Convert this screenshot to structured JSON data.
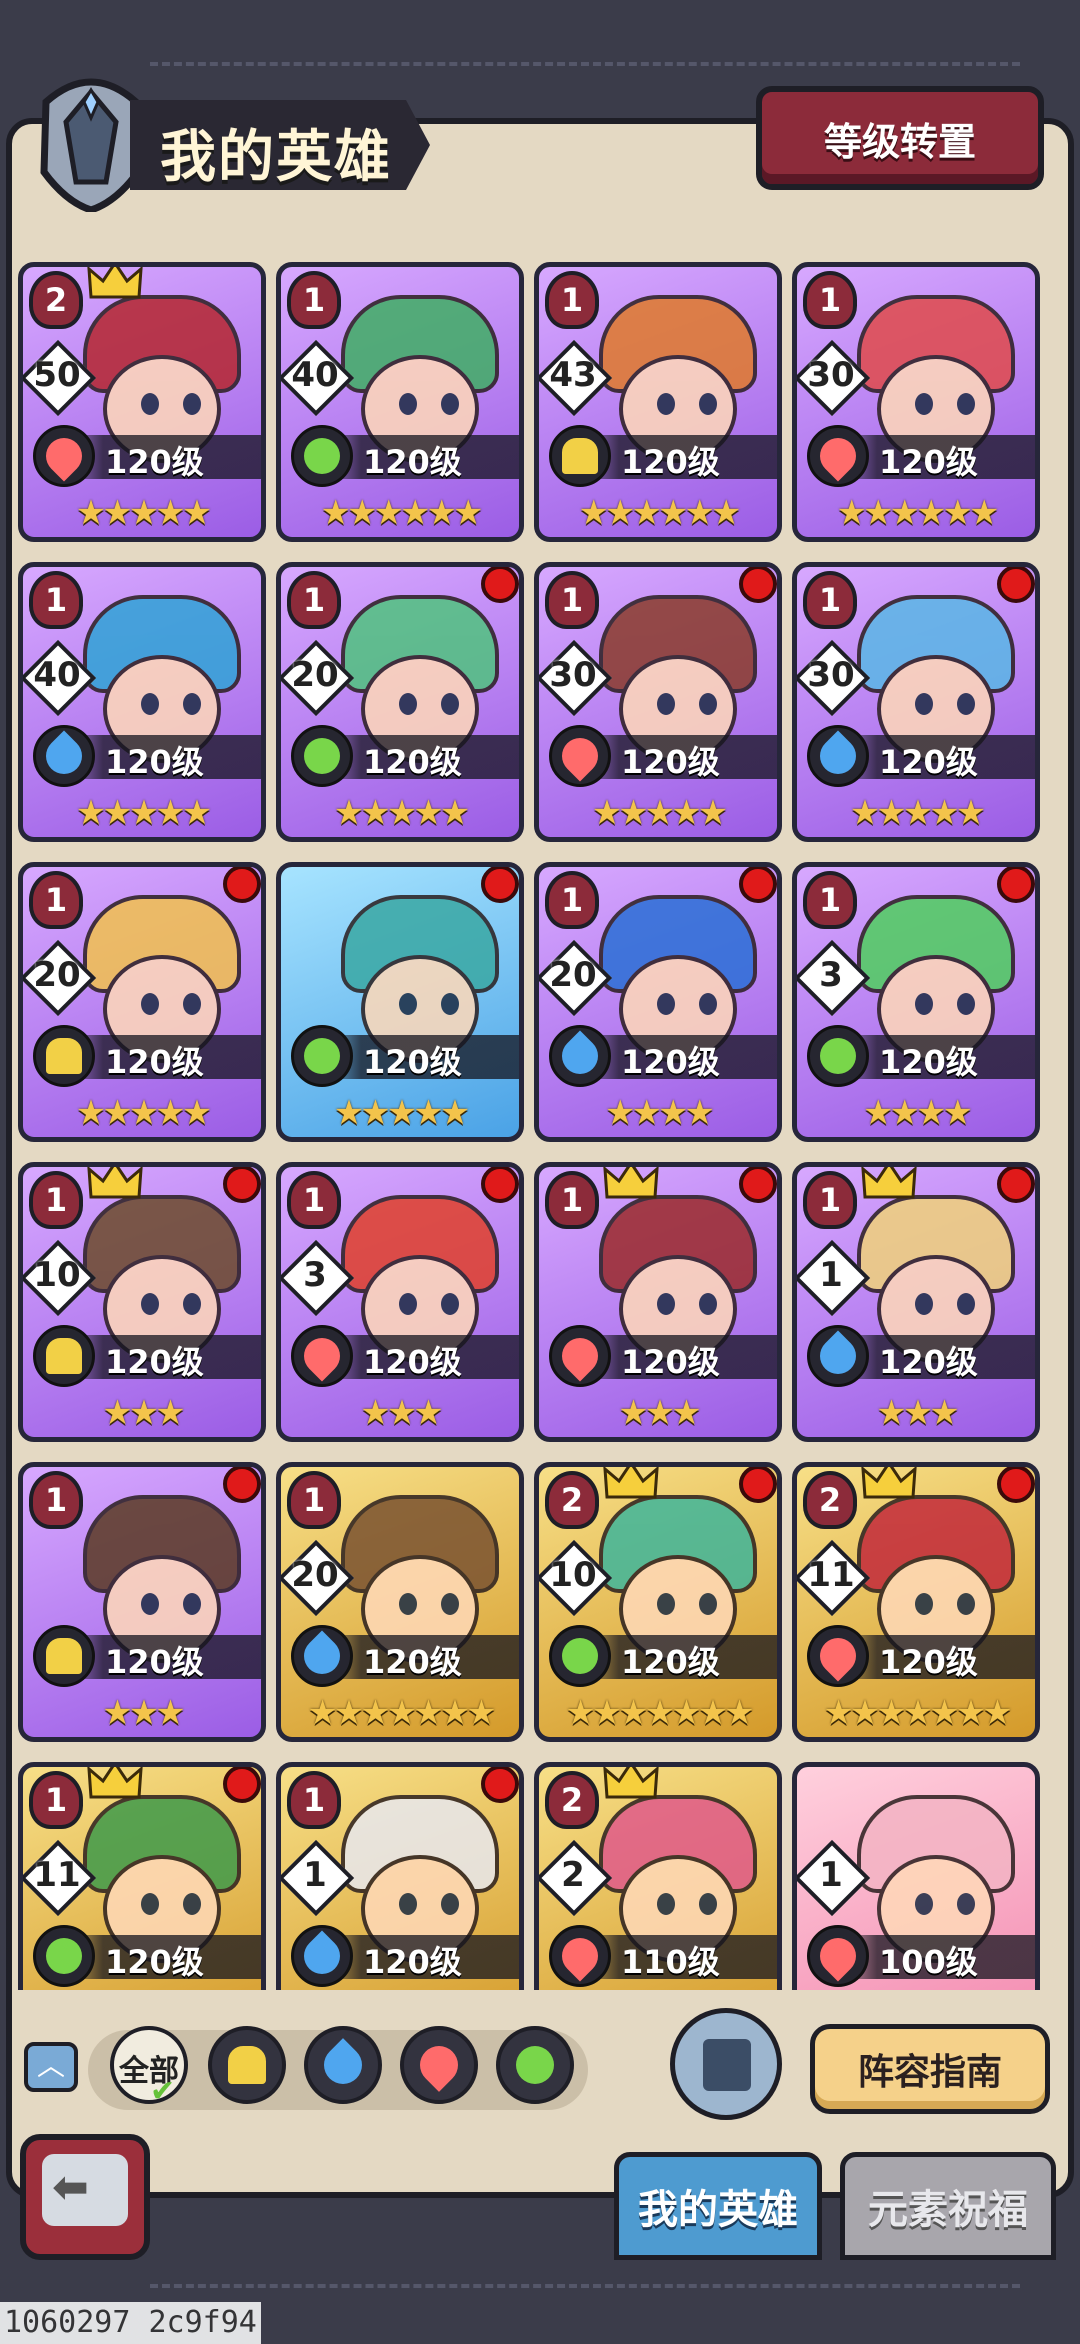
{
  "header": {
    "title": "我的英雄",
    "level_reset_label": "等级转置"
  },
  "heroes": [
    {
      "rank": "2",
      "level_num": "50",
      "element": "fire",
      "level": "120级",
      "stars": "★★★★★",
      "crown": true,
      "dot": false,
      "frame": "purple",
      "hair": "#b4262e"
    },
    {
      "rank": "1",
      "level_num": "40",
      "element": "wind",
      "level": "120级",
      "stars": "★★★★★★",
      "crown": false,
      "dot": false,
      "frame": "purple",
      "hair": "#3fae63"
    },
    {
      "rank": "1",
      "level_num": "43",
      "element": "earth",
      "level": "120级",
      "stars": "★★★★★★",
      "crown": false,
      "dot": false,
      "frame": "purple",
      "hair": "#e07a2a"
    },
    {
      "rank": "1",
      "level_num": "30",
      "element": "fire",
      "level": "120级",
      "stars": "★★★★★★",
      "crown": false,
      "dot": false,
      "frame": "purple",
      "hair": "#e04a4a"
    },
    {
      "rank": "1",
      "level_num": "40",
      "element": "water",
      "level": "120级",
      "stars": "★★★★★",
      "crown": false,
      "dot": false,
      "frame": "purple",
      "hair": "#2fa3d6"
    },
    {
      "rank": "1",
      "level_num": "20",
      "element": "wind",
      "level": "120级",
      "stars": "★★★★★",
      "crown": false,
      "dot": true,
      "frame": "purple",
      "hair": "#4fc37e"
    },
    {
      "rank": "1",
      "level_num": "30",
      "element": "fire",
      "level": "120级",
      "stars": "★★★★★",
      "crown": false,
      "dot": true,
      "frame": "purple",
      "hair": "#8a3b2a"
    },
    {
      "rank": "1",
      "level_num": "30",
      "element": "water",
      "level": "120级",
      "stars": "★★★★★",
      "crown": false,
      "dot": true,
      "frame": "purple",
      "hair": "#5ab7e6"
    },
    {
      "rank": "1",
      "level_num": "20",
      "element": "earth",
      "level": "120级",
      "stars": "★★★★★",
      "crown": false,
      "dot": true,
      "frame": "purple",
      "hair": "#f2c14e"
    },
    {
      "rank": "",
      "level_num": "",
      "element": "wind",
      "level": "120级",
      "stars": "★★★★★",
      "crown": false,
      "dot": true,
      "frame": "blue",
      "hair": "#3aa8a4"
    },
    {
      "rank": "1",
      "level_num": "20",
      "element": "water",
      "level": "120级",
      "stars": "★★★★",
      "crown": false,
      "dot": true,
      "frame": "purple",
      "hair": "#2a6fd6"
    },
    {
      "rank": "1",
      "level_num": "3",
      "element": "wind",
      "level": "120级",
      "stars": "★★★★",
      "crown": false,
      "dot": true,
      "frame": "purple",
      "hair": "#4fcf5e"
    },
    {
      "rank": "1",
      "level_num": "10",
      "element": "earth",
      "level": "120级",
      "stars": "★★★",
      "crown": true,
      "dot": true,
      "frame": "purple",
      "hair": "#6b4a2a"
    },
    {
      "rank": "1",
      "level_num": "3",
      "element": "fire",
      "level": "120级",
      "stars": "★★★",
      "crown": false,
      "dot": true,
      "frame": "purple",
      "hair": "#e0402a"
    },
    {
      "rank": "1",
      "level_num": "",
      "element": "fire",
      "level": "120级",
      "stars": "★★★",
      "crown": true,
      "dot": true,
      "frame": "purple",
      "hair": "#9a2a2a"
    },
    {
      "rank": "1",
      "level_num": "1",
      "element": "water",
      "level": "120级",
      "stars": "★★★",
      "crown": true,
      "dot": true,
      "frame": "purple",
      "hair": "#f0d27a"
    },
    {
      "rank": "1",
      "level_num": "",
      "element": "earth",
      "level": "120级",
      "stars": "★★★",
      "crown": false,
      "dot": true,
      "frame": "purple",
      "hair": "#5a3a22"
    },
    {
      "rank": "1",
      "level_num": "20",
      "element": "water",
      "level": "120级",
      "stars": "★★★★★★★",
      "crown": false,
      "dot": false,
      "frame": "gold",
      "hair": "#7a5230"
    },
    {
      "rank": "2",
      "level_num": "10",
      "element": "wind",
      "level": "120级",
      "stars": "★★★★★★★",
      "crown": true,
      "dot": true,
      "frame": "gold",
      "hair": "#3fb59a"
    },
    {
      "rank": "2",
      "level_num": "11",
      "element": "fire",
      "level": "120级",
      "stars": "★★★★★★★",
      "crown": true,
      "dot": true,
      "frame": "gold",
      "hair": "#c2283a"
    },
    {
      "rank": "1",
      "level_num": "11",
      "element": "wind",
      "level": "120级",
      "stars": "",
      "crown": true,
      "dot": true,
      "frame": "gold",
      "hair": "#3f9a4a"
    },
    {
      "rank": "1",
      "level_num": "1",
      "element": "water",
      "level": "120级",
      "stars": "",
      "crown": false,
      "dot": true,
      "frame": "gold",
      "hair": "#e8e8ee"
    },
    {
      "rank": "2",
      "level_num": "2",
      "element": "fire",
      "level": "110级",
      "stars": "",
      "crown": true,
      "dot": false,
      "frame": "gold",
      "hair": "#e05a8a"
    },
    {
      "rank": "",
      "level_num": "1",
      "element": "fire",
      "level": "100级",
      "stars": "",
      "crown": false,
      "dot": false,
      "frame": "pink",
      "hair": "#f3b4c4"
    }
  ],
  "filters": {
    "all_label": "全部",
    "elements": [
      "earth",
      "water",
      "fire",
      "wind"
    ]
  },
  "buttons": {
    "guide_label": "阵容指南"
  },
  "tabs": [
    {
      "label": "我的英雄",
      "active": true
    },
    {
      "label": "元素祝福",
      "active": false
    }
  ],
  "debug_text": "1060297 2c9f94"
}
